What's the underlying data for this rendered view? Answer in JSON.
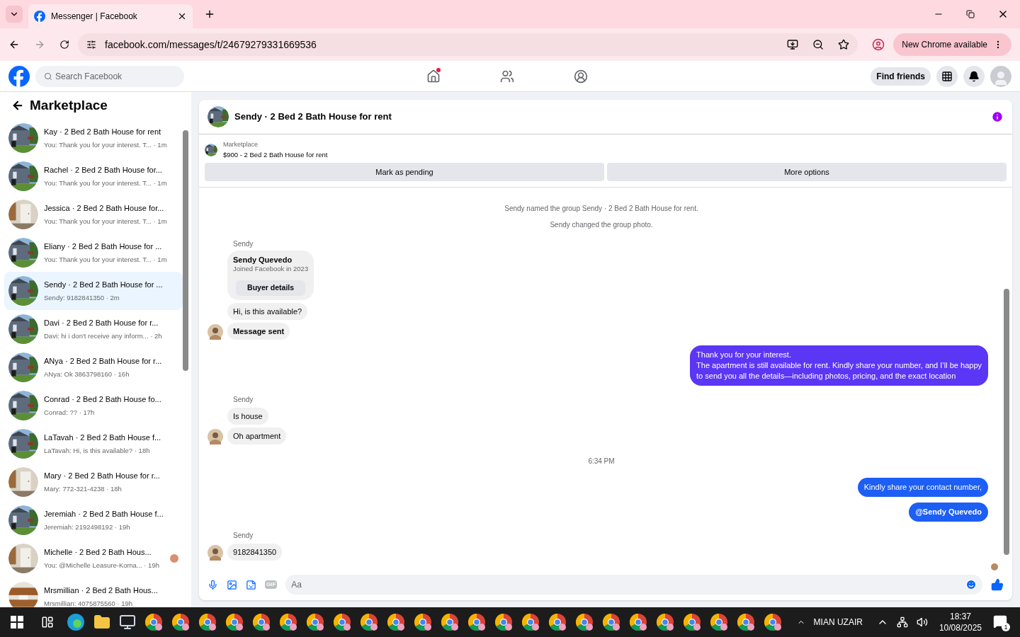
{
  "browser": {
    "tabs": [
      {
        "title": "Messenger | Facebook",
        "selected": true
      }
    ],
    "url": "facebook.com/messages/t/24679279331669536",
    "update_button": "New Chrome available"
  },
  "facebook": {
    "search": {
      "placeholder": "Search Facebook"
    },
    "nav": [
      {
        "kind": "home",
        "badge": true
      },
      {
        "kind": "friends",
        "badge": false
      },
      {
        "kind": "groups",
        "badge": false
      }
    ],
    "find_friends": "Find friends"
  },
  "sidebar": {
    "title": "Marketplace",
    "items": [
      {
        "title": "Kay · 2 Bed 2 Bath House for rent",
        "preview": "You: Thank you for your interest. T... · 1m",
        "selected": false,
        "seen": false
      },
      {
        "title": "Rachel · 2 Bed 2 Bath House for...",
        "preview": "You: Thank you for your interest. T... · 1m",
        "selected": false,
        "seen": false
      },
      {
        "title": "Jessica · 2 Bed 2 Bath House for...",
        "preview": "You: Thank you for your interest. T... · 1m",
        "selected": false,
        "seen": false
      },
      {
        "title": "Eliany · 2 Bed 2 Bath House for ...",
        "preview": "You: Thank you for your interest. T... · 1m",
        "selected": false,
        "seen": false
      },
      {
        "title": "Sendy · 2 Bed 2 Bath House for ...",
        "preview": "Sendy: 9182841350 · 2m",
        "selected": true,
        "seen": false
      },
      {
        "title": "Davi · 2 Bed 2 Bath House for r...",
        "preview": "Davi: hi i don't receive any inform... · 2h",
        "selected": false,
        "seen": false
      },
      {
        "title": "ANya · 2 Bed 2 Bath House for r...",
        "preview": "ANya: Ok 3863798160 · 16h",
        "selected": false,
        "seen": false
      },
      {
        "title": "Conrad · 2 Bed 2 Bath House fo...",
        "preview": "Conrad: ?? · 17h",
        "selected": false,
        "seen": false
      },
      {
        "title": "LaTavah · 2 Bed 2 Bath House f...",
        "preview": "LaTavah: Hi, is this available? · 18h",
        "selected": false,
        "seen": false
      },
      {
        "title": "Mary · 2 Bed 2 Bath House for r...",
        "preview": "Mary: 772-321-4238 · 18h",
        "selected": false,
        "seen": false
      },
      {
        "title": "Jeremiah · 2 Bed 2 Bath House f...",
        "preview": "Jeremiah: 2192498192 · 19h",
        "selected": false,
        "seen": false
      },
      {
        "title": "Michelle · 2 Bed 2 Bath Hous...",
        "preview": "You: @Michelle Leasure-Koma... · 19h",
        "selected": false,
        "seen": true
      },
      {
        "title": "Mrsmillian · 2 Bed 2 Bath Hous...",
        "preview": "Mrsmillian: 4075875560 · 19h",
        "selected": false,
        "seen": false
      }
    ]
  },
  "chat": {
    "title": "Sendy · 2 Bed 2 Bath House for rent",
    "listing": {
      "label": "Marketplace",
      "name": "$900 - 2 Bed 2 Bath House for rent"
    },
    "actions": [
      "Mark as pending",
      "More options"
    ],
    "messages": [
      {
        "kind": "system",
        "text": "Sendy named the group Sendy · 2 Bed 2 Bath House for rent."
      },
      {
        "kind": "system",
        "text": "Sendy changed the group photo."
      },
      {
        "kind": "sender",
        "text": "Sendy"
      },
      {
        "kind": "card",
        "name": "Sendy Quevedo",
        "detail": "Joined Facebook in 2023",
        "button": "Buyer details"
      },
      {
        "kind": "incoming",
        "text": "Hi, is this available?",
        "avatar": false,
        "bold": false
      },
      {
        "kind": "incoming",
        "text": "Message sent",
        "avatar": true,
        "bold": true
      },
      {
        "kind": "outgoing",
        "lines": [
          "Thank you for your interest.",
          "The apartment is still available for rent. Kindly share your number, and I’ll be happy",
          "to send you all the details—including photos, pricing, and the exact location"
        ],
        "color": "#5b36f5",
        "bold": false
      },
      {
        "kind": "sender",
        "text": "Sendy"
      },
      {
        "kind": "incoming",
        "text": "Is house",
        "avatar": false,
        "bold": false
      },
      {
        "kind": "incoming",
        "text": "Oh apartment",
        "avatar": true,
        "bold": false
      },
      {
        "kind": "time",
        "text": "6:34 PM"
      },
      {
        "kind": "outgoing",
        "lines": [
          "Kindly share your contact number,"
        ],
        "color": "#1d5ef5",
        "bold": false
      },
      {
        "kind": "outgoing",
        "lines": [
          "@Sendy Quevedo"
        ],
        "color": "#1d5ef5",
        "bold": true
      },
      {
        "kind": "sender",
        "text": "Sendy"
      },
      {
        "kind": "incoming",
        "text": "9182841350",
        "avatar": true,
        "bold": false
      }
    ],
    "composer": {
      "gif_label": "GIF",
      "placeholder": "Aa"
    }
  },
  "taskbar": {
    "user": "MIAN UZAIR",
    "time": "18:37",
    "date": "10/08/2025",
    "notifications": "1"
  }
}
